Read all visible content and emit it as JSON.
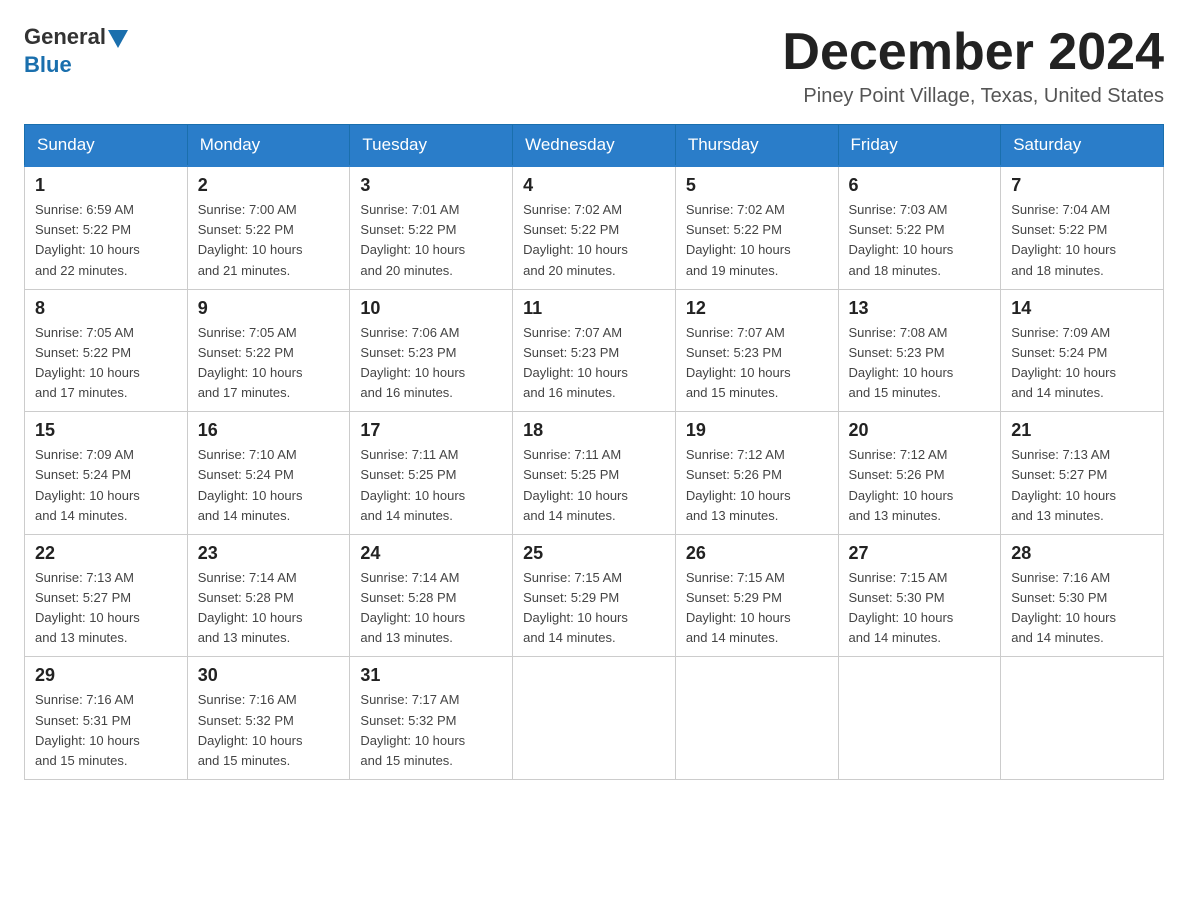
{
  "logo": {
    "general": "General",
    "blue": "Blue"
  },
  "title": "December 2024",
  "location": "Piney Point Village, Texas, United States",
  "days_of_week": [
    "Sunday",
    "Monday",
    "Tuesday",
    "Wednesday",
    "Thursday",
    "Friday",
    "Saturday"
  ],
  "weeks": [
    [
      {
        "day": "1",
        "sunrise": "6:59 AM",
        "sunset": "5:22 PM",
        "daylight": "10 hours and 22 minutes."
      },
      {
        "day": "2",
        "sunrise": "7:00 AM",
        "sunset": "5:22 PM",
        "daylight": "10 hours and 21 minutes."
      },
      {
        "day": "3",
        "sunrise": "7:01 AM",
        "sunset": "5:22 PM",
        "daylight": "10 hours and 20 minutes."
      },
      {
        "day": "4",
        "sunrise": "7:02 AM",
        "sunset": "5:22 PM",
        "daylight": "10 hours and 20 minutes."
      },
      {
        "day": "5",
        "sunrise": "7:02 AM",
        "sunset": "5:22 PM",
        "daylight": "10 hours and 19 minutes."
      },
      {
        "day": "6",
        "sunrise": "7:03 AM",
        "sunset": "5:22 PM",
        "daylight": "10 hours and 18 minutes."
      },
      {
        "day": "7",
        "sunrise": "7:04 AM",
        "sunset": "5:22 PM",
        "daylight": "10 hours and 18 minutes."
      }
    ],
    [
      {
        "day": "8",
        "sunrise": "7:05 AM",
        "sunset": "5:22 PM",
        "daylight": "10 hours and 17 minutes."
      },
      {
        "day": "9",
        "sunrise": "7:05 AM",
        "sunset": "5:22 PM",
        "daylight": "10 hours and 17 minutes."
      },
      {
        "day": "10",
        "sunrise": "7:06 AM",
        "sunset": "5:23 PM",
        "daylight": "10 hours and 16 minutes."
      },
      {
        "day": "11",
        "sunrise": "7:07 AM",
        "sunset": "5:23 PM",
        "daylight": "10 hours and 16 minutes."
      },
      {
        "day": "12",
        "sunrise": "7:07 AM",
        "sunset": "5:23 PM",
        "daylight": "10 hours and 15 minutes."
      },
      {
        "day": "13",
        "sunrise": "7:08 AM",
        "sunset": "5:23 PM",
        "daylight": "10 hours and 15 minutes."
      },
      {
        "day": "14",
        "sunrise": "7:09 AM",
        "sunset": "5:24 PM",
        "daylight": "10 hours and 14 minutes."
      }
    ],
    [
      {
        "day": "15",
        "sunrise": "7:09 AM",
        "sunset": "5:24 PM",
        "daylight": "10 hours and 14 minutes."
      },
      {
        "day": "16",
        "sunrise": "7:10 AM",
        "sunset": "5:24 PM",
        "daylight": "10 hours and 14 minutes."
      },
      {
        "day": "17",
        "sunrise": "7:11 AM",
        "sunset": "5:25 PM",
        "daylight": "10 hours and 14 minutes."
      },
      {
        "day": "18",
        "sunrise": "7:11 AM",
        "sunset": "5:25 PM",
        "daylight": "10 hours and 14 minutes."
      },
      {
        "day": "19",
        "sunrise": "7:12 AM",
        "sunset": "5:26 PM",
        "daylight": "10 hours and 13 minutes."
      },
      {
        "day": "20",
        "sunrise": "7:12 AM",
        "sunset": "5:26 PM",
        "daylight": "10 hours and 13 minutes."
      },
      {
        "day": "21",
        "sunrise": "7:13 AM",
        "sunset": "5:27 PM",
        "daylight": "10 hours and 13 minutes."
      }
    ],
    [
      {
        "day": "22",
        "sunrise": "7:13 AM",
        "sunset": "5:27 PM",
        "daylight": "10 hours and 13 minutes."
      },
      {
        "day": "23",
        "sunrise": "7:14 AM",
        "sunset": "5:28 PM",
        "daylight": "10 hours and 13 minutes."
      },
      {
        "day": "24",
        "sunrise": "7:14 AM",
        "sunset": "5:28 PM",
        "daylight": "10 hours and 13 minutes."
      },
      {
        "day": "25",
        "sunrise": "7:15 AM",
        "sunset": "5:29 PM",
        "daylight": "10 hours and 14 minutes."
      },
      {
        "day": "26",
        "sunrise": "7:15 AM",
        "sunset": "5:29 PM",
        "daylight": "10 hours and 14 minutes."
      },
      {
        "day": "27",
        "sunrise": "7:15 AM",
        "sunset": "5:30 PM",
        "daylight": "10 hours and 14 minutes."
      },
      {
        "day": "28",
        "sunrise": "7:16 AM",
        "sunset": "5:30 PM",
        "daylight": "10 hours and 14 minutes."
      }
    ],
    [
      {
        "day": "29",
        "sunrise": "7:16 AM",
        "sunset": "5:31 PM",
        "daylight": "10 hours and 15 minutes."
      },
      {
        "day": "30",
        "sunrise": "7:16 AM",
        "sunset": "5:32 PM",
        "daylight": "10 hours and 15 minutes."
      },
      {
        "day": "31",
        "sunrise": "7:17 AM",
        "sunset": "5:32 PM",
        "daylight": "10 hours and 15 minutes."
      },
      null,
      null,
      null,
      null
    ]
  ],
  "labels": {
    "sunrise": "Sunrise:",
    "sunset": "Sunset:",
    "daylight": "Daylight:"
  }
}
